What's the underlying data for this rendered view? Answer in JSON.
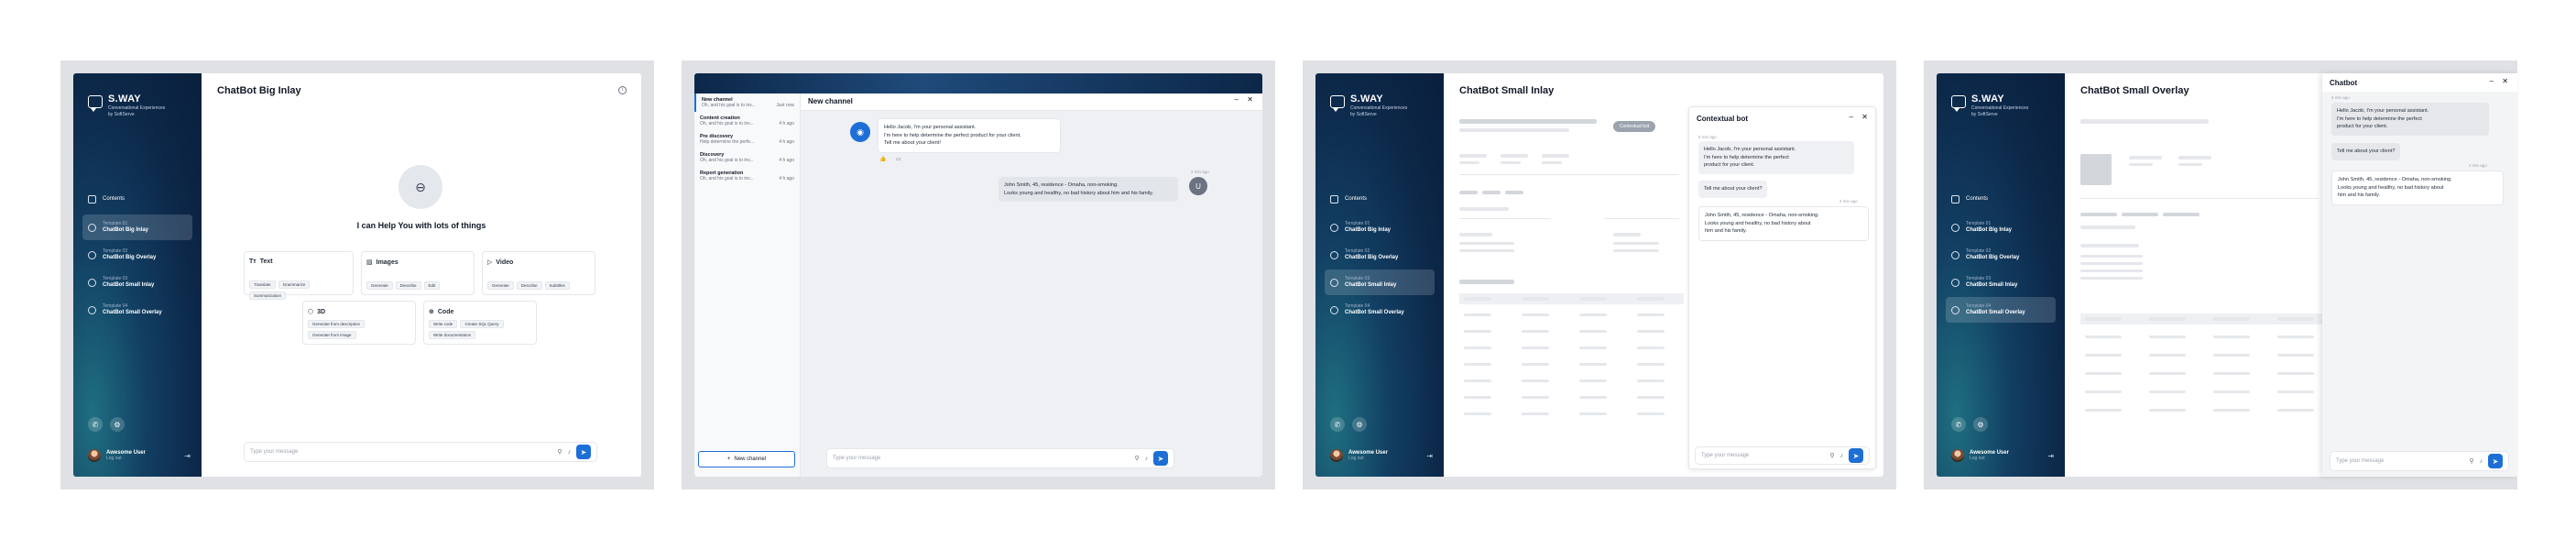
{
  "brand": {
    "name": "S.WAY",
    "tagline_1": "Conversational Experiences",
    "tagline_2": "by SoftServe"
  },
  "sidebar": {
    "contents": "Contents",
    "items": [
      {
        "sub": "Template 01",
        "title": "ChatBot Big Inlay"
      },
      {
        "sub": "Template 02",
        "title": "ChatBot Big Overlay"
      },
      {
        "sub": "Template 03",
        "title": "ChatBot Small Inlay"
      },
      {
        "sub": "Template 04",
        "title": "ChatBot Small Overlay"
      }
    ]
  },
  "user": {
    "name": "Awesome User",
    "action": "Log out"
  },
  "input": {
    "placeholder": "Type your message"
  },
  "panel1": {
    "title": "ChatBot Big Inlay",
    "help_title": "I can Help You with lots of things",
    "cards": [
      {
        "icon": "Tт",
        "title": "Text",
        "chips": [
          "Translate",
          "Grammarize",
          "Summarization"
        ]
      },
      {
        "icon": "▨",
        "title": "Images",
        "chips": [
          "Generate",
          "Describe",
          "Edit"
        ]
      },
      {
        "icon": "▷",
        "title": "Video",
        "chips": [
          "Generate",
          "Describe",
          "Subtitles"
        ]
      },
      {
        "icon": "⬡",
        "title": "3D",
        "chips": [
          "Generate from description",
          "Generate from image"
        ]
      },
      {
        "icon": "⊕",
        "title": "Code",
        "chips": [
          "Write code",
          "Create SQL Query",
          "Write documentation"
        ]
      }
    ]
  },
  "panel2": {
    "window_title": "New channel",
    "channels": [
      {
        "title": "New channel",
        "snippet": "Oh, and his goal is to inv...",
        "time": "Just now"
      },
      {
        "title": "Content creation",
        "snippet": "Oh, and his goal is to inv...",
        "time": "4 h ago"
      },
      {
        "title": "Pre discovery",
        "snippet": "Help determine the perfe...",
        "time": "4 h ago"
      },
      {
        "title": "Discovery",
        "snippet": "Oh, and his goal is to inv...",
        "time": "4 h ago"
      },
      {
        "title": "Report generation",
        "snippet": "Oh, and his goal is to inv...",
        "time": "4 h ago"
      }
    ],
    "new_channel_button": "New channel",
    "bot_message": [
      "Hello Jacob, I'm your personal assistant.",
      "I'm here to help determine the perfect product for your client.",
      "Tell me about your client!"
    ],
    "user_time": "2 min ago",
    "user_initial": "U",
    "user_message": [
      "John Smith, 45, residence - Omaha, non-smoking.",
      "Looks young and healthy, no bad history about him and his family."
    ]
  },
  "panel3": {
    "title": "ChatBot Small Inlay",
    "contextual_button": "Contextual bot",
    "chat_title": "Contextual bot",
    "bot_time": "5 min ago",
    "bot_message": [
      "Hello Jacob, I'm your personal assistant.",
      "I'm here to help determine the perfect",
      "product for your client."
    ],
    "bot_followup": "Tell me about your client?",
    "user_time": "2 min ago",
    "user_message": [
      "John Smith, 45, residence - Omaha, non-smoking.",
      "Looks young and healthy, no bad history about",
      "him and his family."
    ]
  },
  "panel4": {
    "title": "ChatBot Small Overlay",
    "chat_title": "Chatbot",
    "bot_time": "5 min ago",
    "bot_message": [
      "Hello Jacob, I'm your personal assistant.",
      "I'm here to help determine the perfect",
      "product for your client."
    ],
    "bot_followup": "Tell me about your client?",
    "user_time": "2 min ago",
    "user_message": [
      "John Smith, 45, residence - Omaha, non-smoking.",
      "Looks young and healthy, no bad history about",
      "him and his family."
    ]
  },
  "colors": {
    "accent": "#1d6fd6",
    "sidebar_dark": "#0c2748",
    "sidebar_teal": "#1f6f80",
    "panel_bg": "#dfe1e5"
  }
}
